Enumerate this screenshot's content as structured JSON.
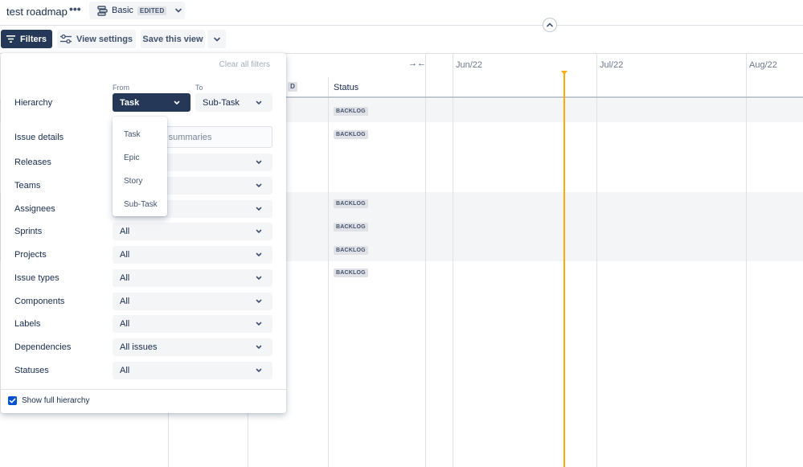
{
  "header": {
    "title": "test roadmap",
    "more_label": "•••",
    "view_name": "Basic",
    "view_state": "EDITED"
  },
  "toolbar": {
    "filters_label": "Filters",
    "view_settings_label": "View settings",
    "save_view_label": "Save this view"
  },
  "timeline": {
    "months": [
      "Jun/22",
      "Jul/22",
      "Aug/22"
    ],
    "status_header": "Status",
    "d_header": "D",
    "expand_icon_text": "→←",
    "status_values": [
      "BACKLOG",
      "BACKLOG",
      "BACKLOG",
      "BACKLOG",
      "BACKLOG",
      "BACKLOG"
    ],
    "today_color": "#ffab00"
  },
  "filters": {
    "clear_all_label": "Clear all filters",
    "from_label": "From",
    "to_label": "To",
    "hierarchy": {
      "label": "Hierarchy",
      "from_value": "Task",
      "to_value": "Sub-Task"
    },
    "issue_details": {
      "label": "Issue details",
      "placeholder": "s, summaries"
    },
    "rows": [
      {
        "label": "Releases",
        "value": ""
      },
      {
        "label": "Teams",
        "value": ""
      },
      {
        "label": "Assignees",
        "value": ""
      },
      {
        "label": "Sprints",
        "value": "All"
      },
      {
        "label": "Projects",
        "value": "All"
      },
      {
        "label": "Issue types",
        "value": "All"
      },
      {
        "label": "Components",
        "value": "All"
      },
      {
        "label": "Labels",
        "value": "All"
      },
      {
        "label": "Dependencies",
        "value": "All issues"
      },
      {
        "label": "Statuses",
        "value": "All"
      }
    ],
    "show_full_hierarchy_label": "Show full hierarchy",
    "show_full_hierarchy_checked": true
  },
  "hierarchy_menu": {
    "items": [
      "Task",
      "Epic",
      "Story",
      "Sub-Task"
    ]
  },
  "colors": {
    "primary": "#253858",
    "checkbox": "#0052cc",
    "today_marker": "#ffab00"
  }
}
